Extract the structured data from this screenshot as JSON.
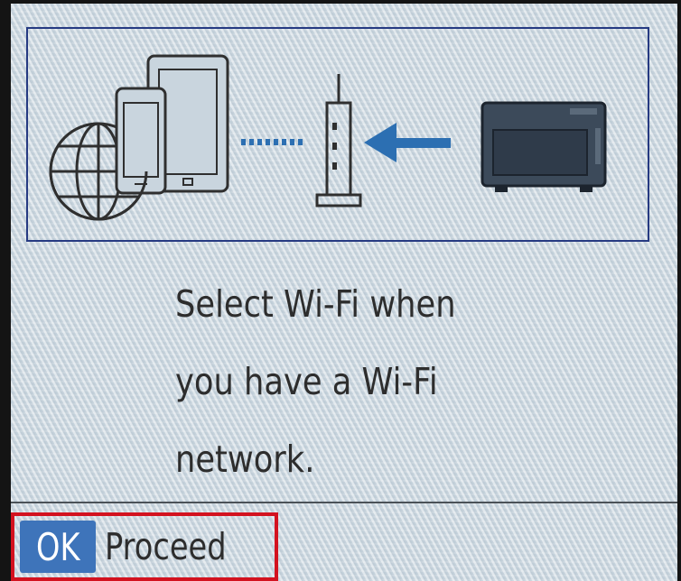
{
  "illustration": {
    "icons": [
      "globe-icon",
      "phone-icon",
      "tablet-icon",
      "wireless-link-icon",
      "router-icon",
      "arrow-left-icon",
      "printer-icon"
    ],
    "colors": {
      "frame": "#263a82",
      "outline": "#2f2f2f",
      "arrow": "#2c6fb2",
      "printer": "#3c4a5a"
    }
  },
  "message": {
    "lines": [
      "Select Wi-Fi when",
      "you have a Wi-Fi",
      "network."
    ]
  },
  "footer": {
    "ok_key": "OK",
    "action_label": "Proceed",
    "ok_key_color": "#3e74ba",
    "highlight_color": "#d3121f"
  }
}
